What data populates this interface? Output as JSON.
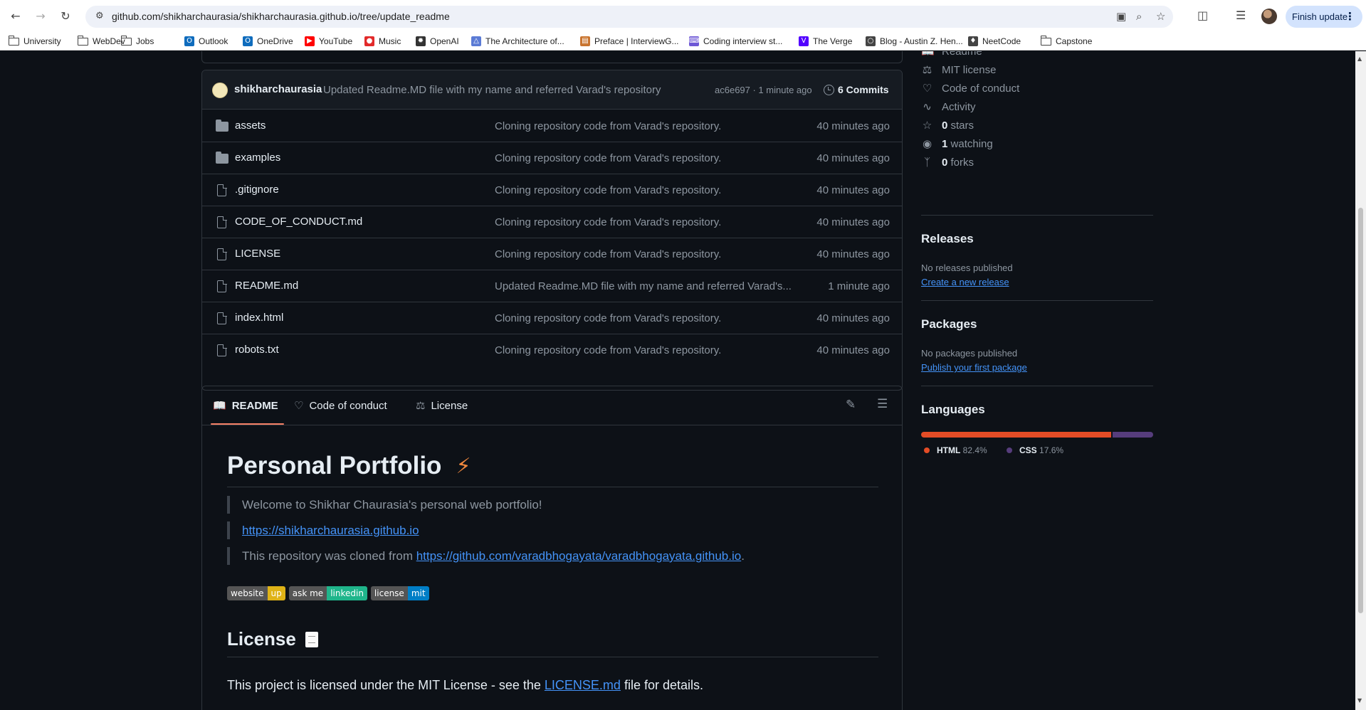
{
  "browser": {
    "url": "github.com/shikharchaurasia/shikharchaurasia.github.io/tree/update_readme",
    "finish_update": "Finish update",
    "bookmarks": [
      {
        "label": "University",
        "icon": "folder"
      },
      {
        "label": "WebDev",
        "icon": "folder"
      },
      {
        "label": "Jobs",
        "icon": "folder"
      },
      {
        "label": "Outlook",
        "icon": "outlook",
        "color": "#0f6cbd"
      },
      {
        "label": "OneDrive",
        "icon": "onedrive",
        "color": "#0f6cbd"
      },
      {
        "label": "YouTube",
        "icon": "youtube",
        "color": "#ff0000"
      },
      {
        "label": "Music",
        "icon": "music",
        "color": "#e22a2a"
      },
      {
        "label": "OpenAI",
        "icon": "openai",
        "color": "#333333"
      },
      {
        "label": "The Architecture of...",
        "icon": "architecture",
        "color": "#5b7bd5"
      },
      {
        "label": "Preface | InterviewG...",
        "icon": "preface",
        "color": "#c9742f"
      },
      {
        "label": "Coding interview st...",
        "icon": "coding",
        "color": "#6e58d6"
      },
      {
        "label": "The Verge",
        "icon": "verge",
        "color": "#5200ff"
      },
      {
        "label": "Blog - Austin Z. Hen...",
        "icon": "globe",
        "color": "#444444"
      },
      {
        "label": "NeetCode",
        "icon": "neetcode",
        "color": "#444444"
      },
      {
        "label": "Capstone",
        "icon": "folder"
      }
    ]
  },
  "commit": {
    "user": "shikharchaurasia",
    "message": "Updated Readme.MD file with my name and referred Varad's repository",
    "hash": "ac6e697 · 1 minute ago",
    "commits_label": "6 Commits"
  },
  "files": [
    {
      "name": "assets",
      "type": "dir",
      "message": "Cloning repository code from Varad's repository.",
      "time": "40 minutes ago"
    },
    {
      "name": "examples",
      "type": "dir",
      "message": "Cloning repository code from Varad's repository.",
      "time": "40 minutes ago"
    },
    {
      "name": ".gitignore",
      "type": "file",
      "message": "Cloning repository code from Varad's repository.",
      "time": "40 minutes ago"
    },
    {
      "name": "CODE_OF_CONDUCT.md",
      "type": "file",
      "message": "Cloning repository code from Varad's repository.",
      "time": "40 minutes ago"
    },
    {
      "name": "LICENSE",
      "type": "file",
      "message": "Cloning repository code from Varad's repository.",
      "time": "40 minutes ago"
    },
    {
      "name": "README.md",
      "type": "file",
      "message": "Updated Readme.MD file with my name and referred Varad's...",
      "time": "1 minute ago"
    },
    {
      "name": "index.html",
      "type": "file",
      "message": "Cloning repository code from Varad's repository.",
      "time": "40 minutes ago"
    },
    {
      "name": "robots.txt",
      "type": "file",
      "message": "Cloning repository code from Varad's repository.",
      "time": "40 minutes ago"
    }
  ],
  "readme_tabs": {
    "readme": "README",
    "conduct": "Code of conduct",
    "license": "License"
  },
  "readme": {
    "title": "Personal Portfolio",
    "welcome": "Welcome to Shikhar Chaurasia's personal web portfolio!",
    "site_link": "https://shikharchaurasia.github.io",
    "cloned_prefix": "This repository was cloned from ",
    "cloned_link": "https://github.com/varadbhogayata/varadbhogayata.github.io",
    "cloned_suffix": ".",
    "badges": [
      {
        "key": "website",
        "value": "up",
        "color": "#dfb317"
      },
      {
        "key": "ask me",
        "value": "linkedin",
        "color": "#1fb58b"
      },
      {
        "key": "license",
        "value": "mit",
        "color": "#007ec6"
      }
    ],
    "license_heading": "License",
    "license_prefix": "This project is licensed under the MIT License - see the ",
    "license_link": "LICENSE.md",
    "license_suffix": " file for details."
  },
  "sidebar": {
    "links": [
      {
        "label": "Readme",
        "icon": "book-icon"
      },
      {
        "label": "MIT license",
        "icon": "scale-icon"
      },
      {
        "label": "Code of conduct",
        "icon": "heart-icon"
      },
      {
        "label": "Activity",
        "icon": "pulse-icon"
      },
      {
        "count": "0",
        "label": "stars",
        "icon": "star-icon"
      },
      {
        "count": "1",
        "label": "watching",
        "icon": "eye-icon"
      },
      {
        "count": "0",
        "label": "forks",
        "icon": "fork-icon"
      }
    ],
    "releases": {
      "title": "Releases",
      "empty": "No releases published",
      "action": "Create a new release"
    },
    "packages": {
      "title": "Packages",
      "empty": "No packages published",
      "action": "Publish your first package"
    },
    "languages": {
      "title": "Languages",
      "items": [
        {
          "name": "HTML",
          "percent": "82.4%",
          "value": 82.4,
          "color": "#e34c26"
        },
        {
          "name": "CSS",
          "percent": "17.6%",
          "value": 17.6,
          "color": "#563d7c"
        }
      ]
    }
  }
}
